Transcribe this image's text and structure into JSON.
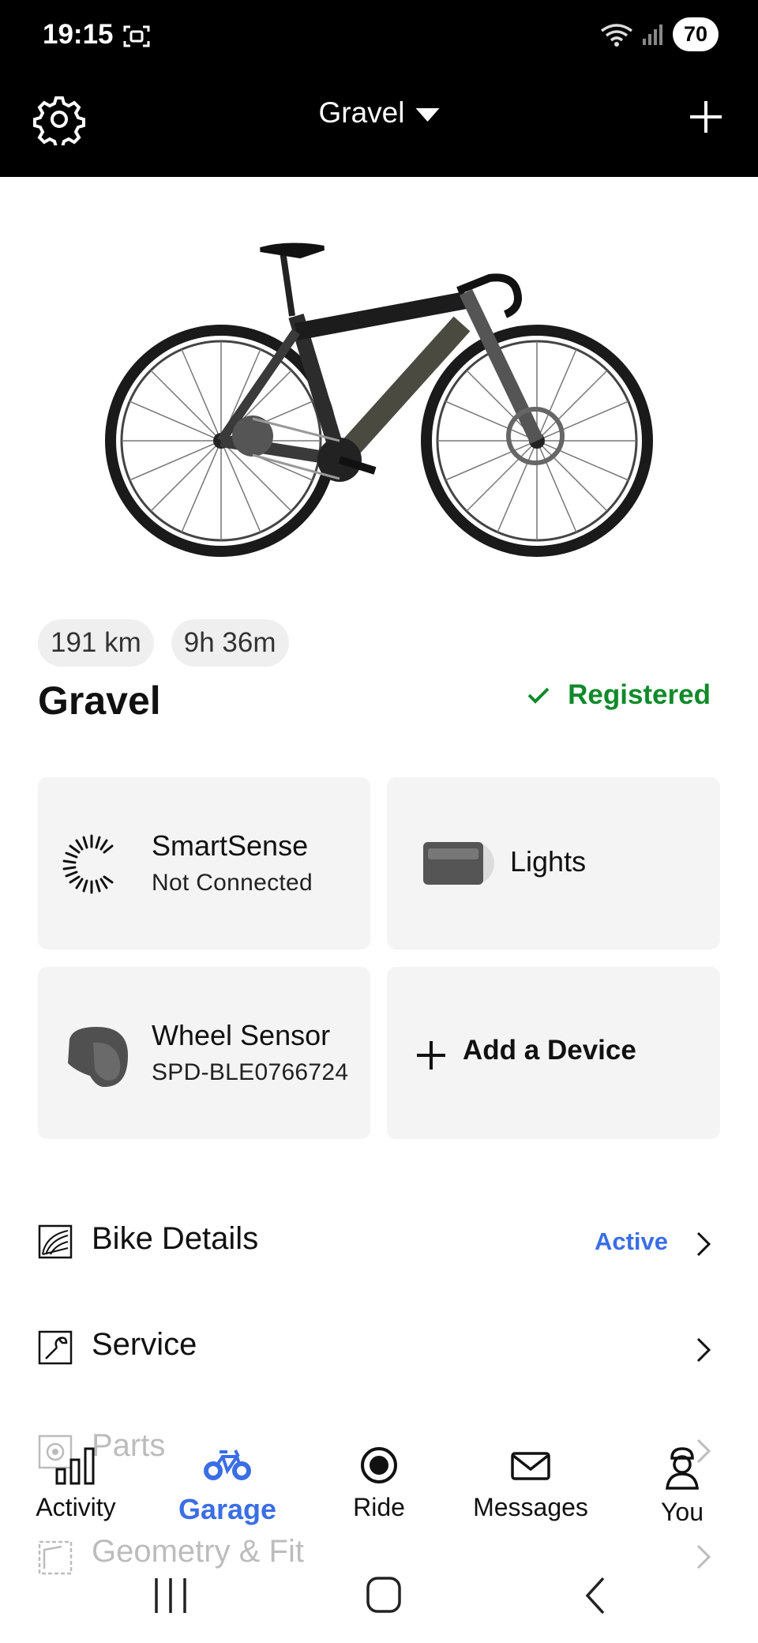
{
  "status_bar": {
    "time": "19:15",
    "battery": "70"
  },
  "header": {
    "title": "Gravel"
  },
  "stats": {
    "distance": "191 km",
    "duration": "9h 36m"
  },
  "bike": {
    "name": "Gravel",
    "registration": "Registered"
  },
  "devices": {
    "smartsense": {
      "name": "SmartSense",
      "status": "Not Connected"
    },
    "lights": {
      "name": "Lights"
    },
    "wheel_sensor": {
      "name": "Wheel Sensor",
      "id": "SPD-BLE0766724"
    },
    "add": {
      "label": "Add a Device"
    }
  },
  "menu": {
    "bike_details": {
      "label": "Bike Details",
      "status": "Active"
    },
    "service": {
      "label": "Service"
    },
    "parts": {
      "label": "Parts"
    },
    "geometry": {
      "label": "Geometry & Fit"
    }
  },
  "nav": {
    "activity": "Activity",
    "garage": "Garage",
    "ride": "Ride",
    "messages": "Messages",
    "you": "You"
  },
  "colors": {
    "accent": "#3b6ee6",
    "registered": "#0f8a2a",
    "card": "#f4f4f4"
  }
}
